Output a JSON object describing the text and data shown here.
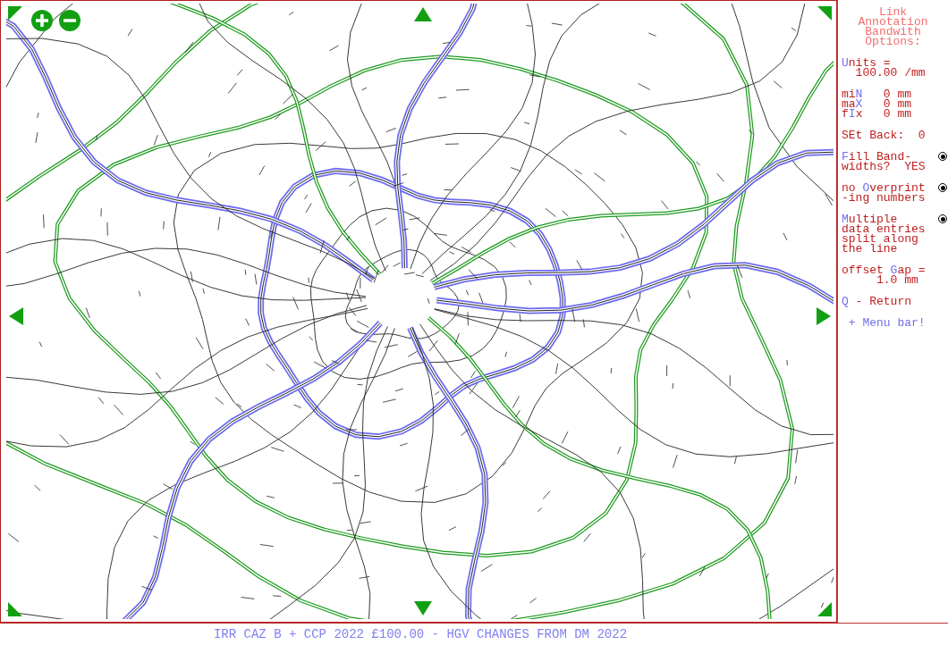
{
  "sidebar": {
    "title_lines": [
      "Link",
      "Annotation",
      "Bandwith",
      "Options:"
    ],
    "entries": [
      {
        "lines": [
          [
            {
              "text": "U",
              "hotkey": true
            },
            {
              "text": "nits =",
              "hotkey": false
            }
          ],
          [
            {
              "text": "  100.00 /mm",
              "hotkey": false
            }
          ]
        ]
      },
      {
        "lines": [
          [
            {
              "text": "mi",
              "hotkey": false
            },
            {
              "text": "N",
              "hotkey": true
            },
            {
              "text": "   0 mm",
              "hotkey": false
            }
          ],
          [
            {
              "text": "ma",
              "hotkey": false
            },
            {
              "text": "X",
              "hotkey": true
            },
            {
              "text": "   0 mm",
              "hotkey": false
            }
          ],
          [
            {
              "text": "f",
              "hotkey": false
            },
            {
              "text": "I",
              "hotkey": true
            },
            {
              "text": "x   0 mm",
              "hotkey": false
            }
          ]
        ]
      },
      {
        "lines": [
          [
            {
              "text": "SEt Back:  0",
              "hotkey": false
            }
          ]
        ]
      },
      {
        "lines": [
          [
            {
              "text": "F",
              "hotkey": true
            },
            {
              "text": "ill Band-",
              "hotkey": false
            }
          ],
          [
            {
              "text": "widths?  YES",
              "hotkey": false
            }
          ]
        ],
        "radio": {
          "selected": true
        }
      },
      {
        "lines": [
          [
            {
              "text": "no ",
              "hotkey": false
            },
            {
              "text": "O",
              "hotkey": true
            },
            {
              "text": "verprint",
              "hotkey": false
            }
          ],
          [
            {
              "text": "-ing numbers",
              "hotkey": false
            }
          ]
        ],
        "radio": {
          "selected": true
        }
      },
      {
        "lines": [
          [
            {
              "text": "M",
              "hotkey": true
            },
            {
              "text": "ultiple",
              "hotkey": false
            }
          ],
          [
            {
              "text": "data entries",
              "hotkey": false
            }
          ],
          [
            {
              "text": "split along",
              "hotkey": false
            }
          ],
          [
            {
              "text": "the line",
              "hotkey": false
            }
          ]
        ],
        "radio": {
          "selected": true
        }
      },
      {
        "lines": [
          [
            {
              "text": "offset ",
              "hotkey": false
            },
            {
              "text": "G",
              "hotkey": true
            },
            {
              "text": "ap =",
              "hotkey": false
            }
          ],
          [
            {
              "text": "     1.0 mm",
              "hotkey": false
            }
          ]
        ]
      },
      {
        "lines": [
          [
            {
              "text": "Q",
              "hotkey": true
            },
            {
              "text": " - Return",
              "hotkey": false
            }
          ]
        ]
      },
      {
        "lines": [
          [
            {
              "text": " + Menu bar!",
              "hotkey": true
            }
          ]
        ]
      }
    ]
  },
  "status_bar": {
    "title": "IRR CAZ B + CCP 2022 £100.00 - HGV CHANGES FROM DM 2022"
  }
}
